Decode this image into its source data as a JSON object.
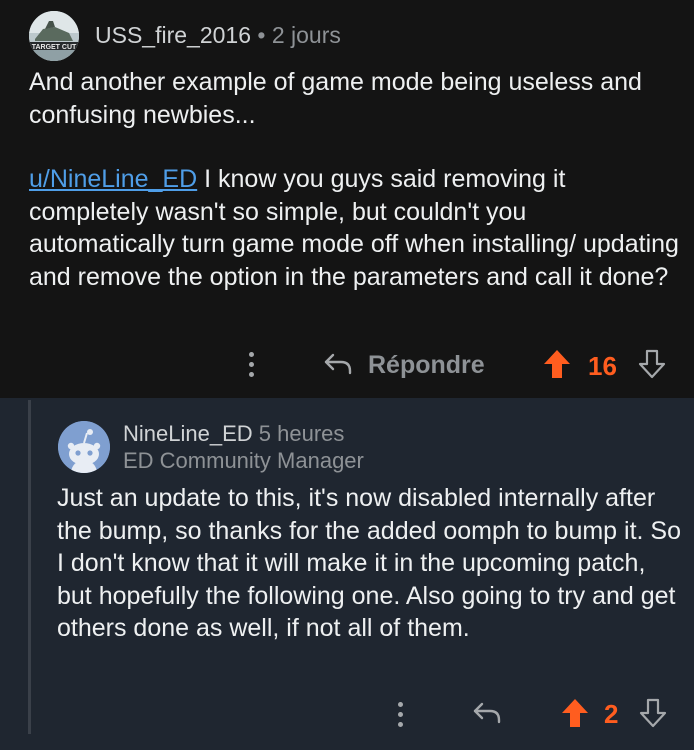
{
  "comment1": {
    "username": "USS_fire_2016",
    "separator": "•",
    "time": "2 jours",
    "avatar_text": "TARGET CUT",
    "paragraph1": "And another example of game mode being useless and confusing newbies...",
    "mention": "u/NineLine_ED",
    "paragraph2_rest": " I know you guys said removing it completely wasn't so simple, but couldn't you automatically turn game mode off when installing/ updating and remove the option in the parameters and call it done?",
    "reply_label": "Répondre",
    "score": "16"
  },
  "comment2": {
    "username": "NineLine_ED",
    "time": "5 heures",
    "flair": "ED Community Manager",
    "body": "Just an update to this, it's now disabled internally after the bump, so thanks for the added oomph to bump it. So I don't know that it will make it in the upcoming patch, but hopefully the following one. Also going to try and get others done as well, if not all of them.",
    "score": "2"
  },
  "icons": {
    "more": "more-vertical-icon",
    "reply": "reply-arrow-icon",
    "upvote": "upvote-arrow-icon",
    "downvote": "downvote-arrow-icon"
  },
  "colors": {
    "upvote": "#ff5d1f",
    "mention_link": "#4f9ee8",
    "reply_background": "#1f2630"
  }
}
